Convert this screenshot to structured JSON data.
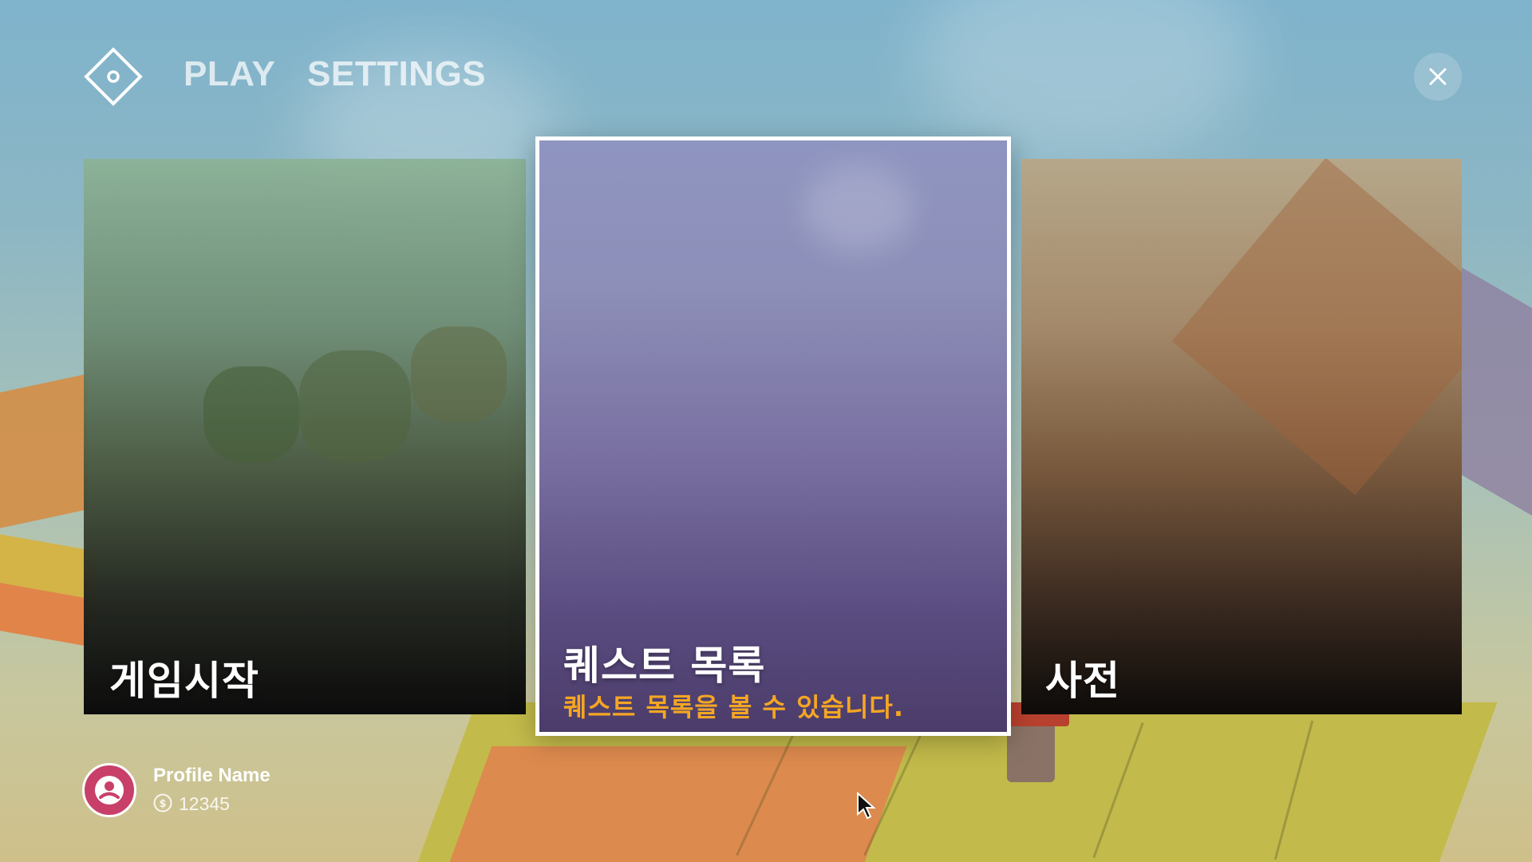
{
  "nav": {
    "tabs": [
      {
        "label": "PLAY"
      },
      {
        "label": "SETTINGS"
      }
    ],
    "logo_icon": "diamond-logo-icon",
    "close_icon": "close-icon"
  },
  "cards": [
    {
      "title": "게임시작",
      "description": ""
    },
    {
      "title": "퀘스트 목록",
      "description": "퀘스트 목록을 볼 수 있습니다.",
      "selected": true
    },
    {
      "title": "사전",
      "description": ""
    }
  ],
  "profile": {
    "name": "Profile Name",
    "currency_icon": "coin-icon",
    "currency_value": "12345"
  },
  "colors": {
    "accent": "#f5a623",
    "avatar": "#c8406a",
    "selection_border": "#ffffff"
  }
}
